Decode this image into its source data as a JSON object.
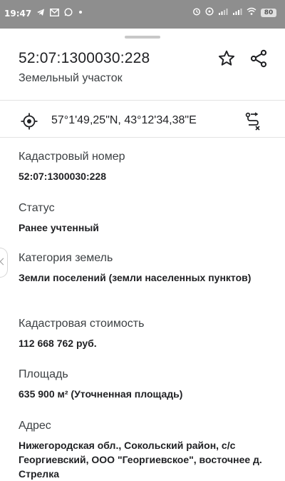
{
  "status_bar": {
    "time": "19:47",
    "left_icons": [
      "telegram-icon",
      "mail-icon",
      "whatsapp-icon",
      "dot-icon"
    ],
    "right_icons": [
      "alarm-icon",
      "clock-icon",
      "signal-icon",
      "signal-icon",
      "wifi-icon"
    ],
    "battery": "80"
  },
  "header": {
    "title": "52:07:1300030:228",
    "subtitle": "Земельный участок",
    "favorite_icon": "star-icon",
    "share_icon": "share-icon"
  },
  "coordinates": {
    "text": "57°1'49,25\"N, 43°12'34,38\"E",
    "locate_icon": "target-icon",
    "route_icon": "route-icon"
  },
  "fields": [
    {
      "label": "Кадастровый номер",
      "value": "52:07:1300030:228"
    },
    {
      "label": "Статус",
      "value": "Ранее учтенный"
    },
    {
      "label": "Категория земель",
      "value": "Земли поселений (земли населенных пунктов)"
    },
    {
      "label": "Кадастровая стоимость",
      "value": "112 668 762 руб."
    },
    {
      "label": "Площадь",
      "value": "635 900 м² (Уточненная площадь)"
    },
    {
      "label": "Адрес",
      "value": "Нижегородская обл., Сокольский район, с/с Георгиевский, ООО \"Георгиевское\", восточнее д. Стрелка"
    }
  ],
  "colors": {
    "status_bar": "#8e8e8e",
    "text_primary": "#202124",
    "text_secondary": "#3c4043",
    "divider": "#e3e3e3"
  }
}
